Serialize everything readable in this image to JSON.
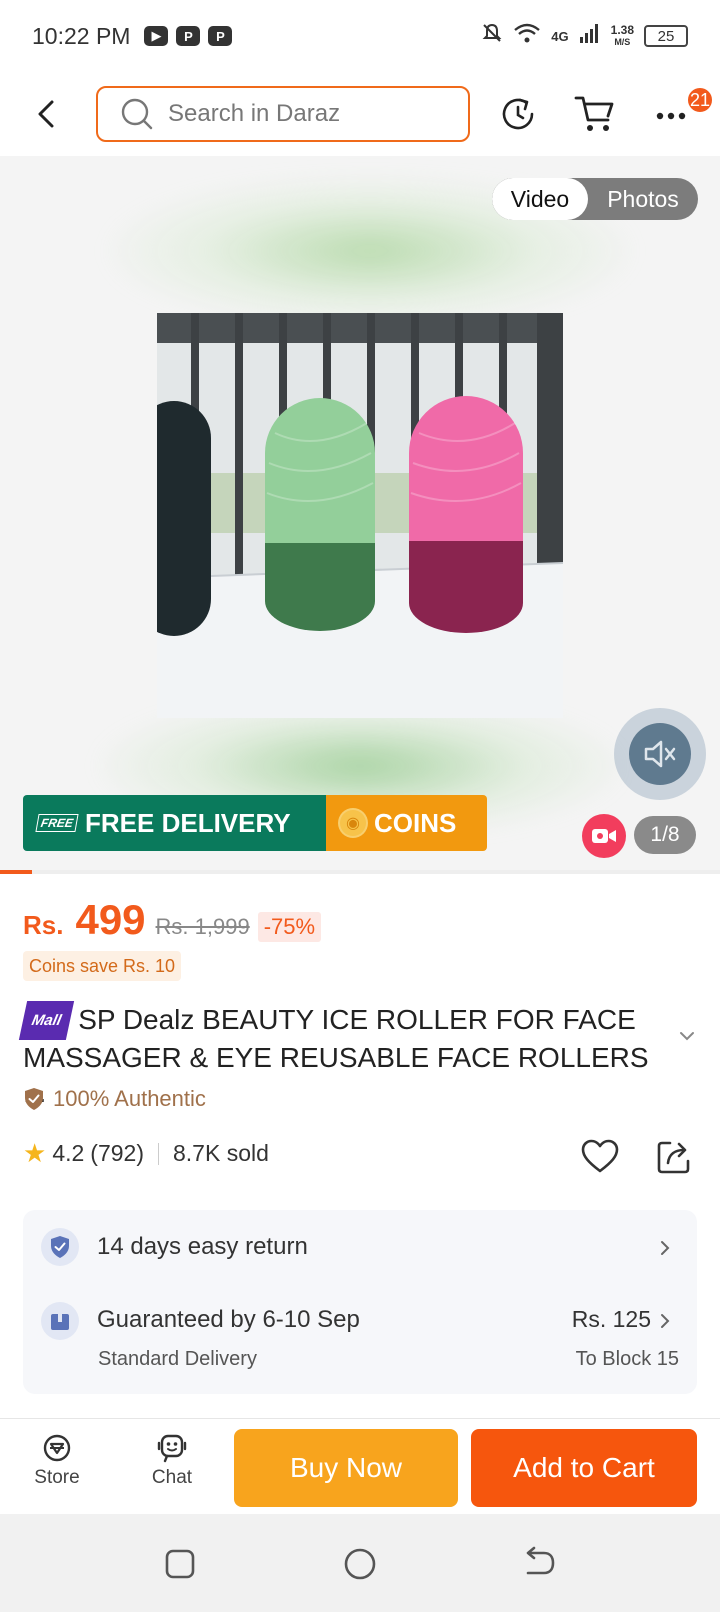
{
  "status_bar": {
    "time": "10:22 PM",
    "network": "4G",
    "speed_value": "1.38",
    "speed_unit": "M/S",
    "battery": "25"
  },
  "top_bar": {
    "search_placeholder": "Search in Daraz",
    "cart_badge": "21",
    "icons": [
      "back-arrow-icon",
      "search-icon",
      "history-icon",
      "cart-icon",
      "more-icon"
    ]
  },
  "gallery": {
    "toggle": {
      "video_label": "Video",
      "photos_label": "Photos",
      "selected": "Video"
    },
    "page_counter": "1/8",
    "progress_fraction": 0.044,
    "promo": {
      "delivery_tag": "FREE",
      "delivery_label": "FREE DELIVERY",
      "coins_label": "COINS"
    }
  },
  "price": {
    "currency": "Rs.",
    "current": "499",
    "original": "Rs. 1,999",
    "discount": "-75%",
    "coins_save": "Coins save Rs. 10"
  },
  "product": {
    "mall_badge": "Mall",
    "title": "SP Dealz  BEAUTY ICE ROLLER FOR FACE MASSAGER & EYE REUSABLE FACE ROLLERS ...",
    "authentic_label": "100% Authentic",
    "rating": "4.2",
    "reviews": "(792)",
    "sold": "8.7K sold"
  },
  "services": {
    "return_label": "14 days easy return",
    "delivery_title": "Guaranteed by 6-10 Sep",
    "delivery_type": "Standard Delivery",
    "delivery_price": "Rs. 125",
    "delivery_location": "To Block 15"
  },
  "bottom_bar": {
    "store_label": "Store",
    "chat_label": "Chat",
    "buy_now_label": "Buy Now",
    "add_to_cart_label": "Add to Cart"
  },
  "colors": {
    "brand_orange": "#f25a1c",
    "buy_now": "#f8a41d",
    "add_to_cart": "#f6560d",
    "delivery_green": "#0a7a5c",
    "coins_orange": "#f2990f",
    "mall_purple": "#5a2bb0"
  }
}
